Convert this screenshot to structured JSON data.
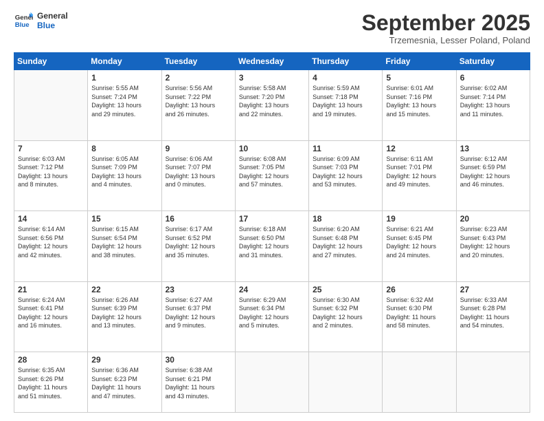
{
  "logo": {
    "line1": "General",
    "line2": "Blue"
  },
  "title": "September 2025",
  "location": "Trzemesnia, Lesser Poland, Poland",
  "days_header": [
    "Sunday",
    "Monday",
    "Tuesday",
    "Wednesday",
    "Thursday",
    "Friday",
    "Saturday"
  ],
  "weeks": [
    [
      {
        "day": "",
        "info": ""
      },
      {
        "day": "1",
        "info": "Sunrise: 5:55 AM\nSunset: 7:24 PM\nDaylight: 13 hours\nand 29 minutes."
      },
      {
        "day": "2",
        "info": "Sunrise: 5:56 AM\nSunset: 7:22 PM\nDaylight: 13 hours\nand 26 minutes."
      },
      {
        "day": "3",
        "info": "Sunrise: 5:58 AM\nSunset: 7:20 PM\nDaylight: 13 hours\nand 22 minutes."
      },
      {
        "day": "4",
        "info": "Sunrise: 5:59 AM\nSunset: 7:18 PM\nDaylight: 13 hours\nand 19 minutes."
      },
      {
        "day": "5",
        "info": "Sunrise: 6:01 AM\nSunset: 7:16 PM\nDaylight: 13 hours\nand 15 minutes."
      },
      {
        "day": "6",
        "info": "Sunrise: 6:02 AM\nSunset: 7:14 PM\nDaylight: 13 hours\nand 11 minutes."
      }
    ],
    [
      {
        "day": "7",
        "info": "Sunrise: 6:03 AM\nSunset: 7:12 PM\nDaylight: 13 hours\nand 8 minutes."
      },
      {
        "day": "8",
        "info": "Sunrise: 6:05 AM\nSunset: 7:09 PM\nDaylight: 13 hours\nand 4 minutes."
      },
      {
        "day": "9",
        "info": "Sunrise: 6:06 AM\nSunset: 7:07 PM\nDaylight: 13 hours\nand 0 minutes."
      },
      {
        "day": "10",
        "info": "Sunrise: 6:08 AM\nSunset: 7:05 PM\nDaylight: 12 hours\nand 57 minutes."
      },
      {
        "day": "11",
        "info": "Sunrise: 6:09 AM\nSunset: 7:03 PM\nDaylight: 12 hours\nand 53 minutes."
      },
      {
        "day": "12",
        "info": "Sunrise: 6:11 AM\nSunset: 7:01 PM\nDaylight: 12 hours\nand 49 minutes."
      },
      {
        "day": "13",
        "info": "Sunrise: 6:12 AM\nSunset: 6:59 PM\nDaylight: 12 hours\nand 46 minutes."
      }
    ],
    [
      {
        "day": "14",
        "info": "Sunrise: 6:14 AM\nSunset: 6:56 PM\nDaylight: 12 hours\nand 42 minutes."
      },
      {
        "day": "15",
        "info": "Sunrise: 6:15 AM\nSunset: 6:54 PM\nDaylight: 12 hours\nand 38 minutes."
      },
      {
        "day": "16",
        "info": "Sunrise: 6:17 AM\nSunset: 6:52 PM\nDaylight: 12 hours\nand 35 minutes."
      },
      {
        "day": "17",
        "info": "Sunrise: 6:18 AM\nSunset: 6:50 PM\nDaylight: 12 hours\nand 31 minutes."
      },
      {
        "day": "18",
        "info": "Sunrise: 6:20 AM\nSunset: 6:48 PM\nDaylight: 12 hours\nand 27 minutes."
      },
      {
        "day": "19",
        "info": "Sunrise: 6:21 AM\nSunset: 6:45 PM\nDaylight: 12 hours\nand 24 minutes."
      },
      {
        "day": "20",
        "info": "Sunrise: 6:23 AM\nSunset: 6:43 PM\nDaylight: 12 hours\nand 20 minutes."
      }
    ],
    [
      {
        "day": "21",
        "info": "Sunrise: 6:24 AM\nSunset: 6:41 PM\nDaylight: 12 hours\nand 16 minutes."
      },
      {
        "day": "22",
        "info": "Sunrise: 6:26 AM\nSunset: 6:39 PM\nDaylight: 12 hours\nand 13 minutes."
      },
      {
        "day": "23",
        "info": "Sunrise: 6:27 AM\nSunset: 6:37 PM\nDaylight: 12 hours\nand 9 minutes."
      },
      {
        "day": "24",
        "info": "Sunrise: 6:29 AM\nSunset: 6:34 PM\nDaylight: 12 hours\nand 5 minutes."
      },
      {
        "day": "25",
        "info": "Sunrise: 6:30 AM\nSunset: 6:32 PM\nDaylight: 12 hours\nand 2 minutes."
      },
      {
        "day": "26",
        "info": "Sunrise: 6:32 AM\nSunset: 6:30 PM\nDaylight: 11 hours\nand 58 minutes."
      },
      {
        "day": "27",
        "info": "Sunrise: 6:33 AM\nSunset: 6:28 PM\nDaylight: 11 hours\nand 54 minutes."
      }
    ],
    [
      {
        "day": "28",
        "info": "Sunrise: 6:35 AM\nSunset: 6:26 PM\nDaylight: 11 hours\nand 51 minutes."
      },
      {
        "day": "29",
        "info": "Sunrise: 6:36 AM\nSunset: 6:23 PM\nDaylight: 11 hours\nand 47 minutes."
      },
      {
        "day": "30",
        "info": "Sunrise: 6:38 AM\nSunset: 6:21 PM\nDaylight: 11 hours\nand 43 minutes."
      },
      {
        "day": "",
        "info": ""
      },
      {
        "day": "",
        "info": ""
      },
      {
        "day": "",
        "info": ""
      },
      {
        "day": "",
        "info": ""
      }
    ]
  ]
}
